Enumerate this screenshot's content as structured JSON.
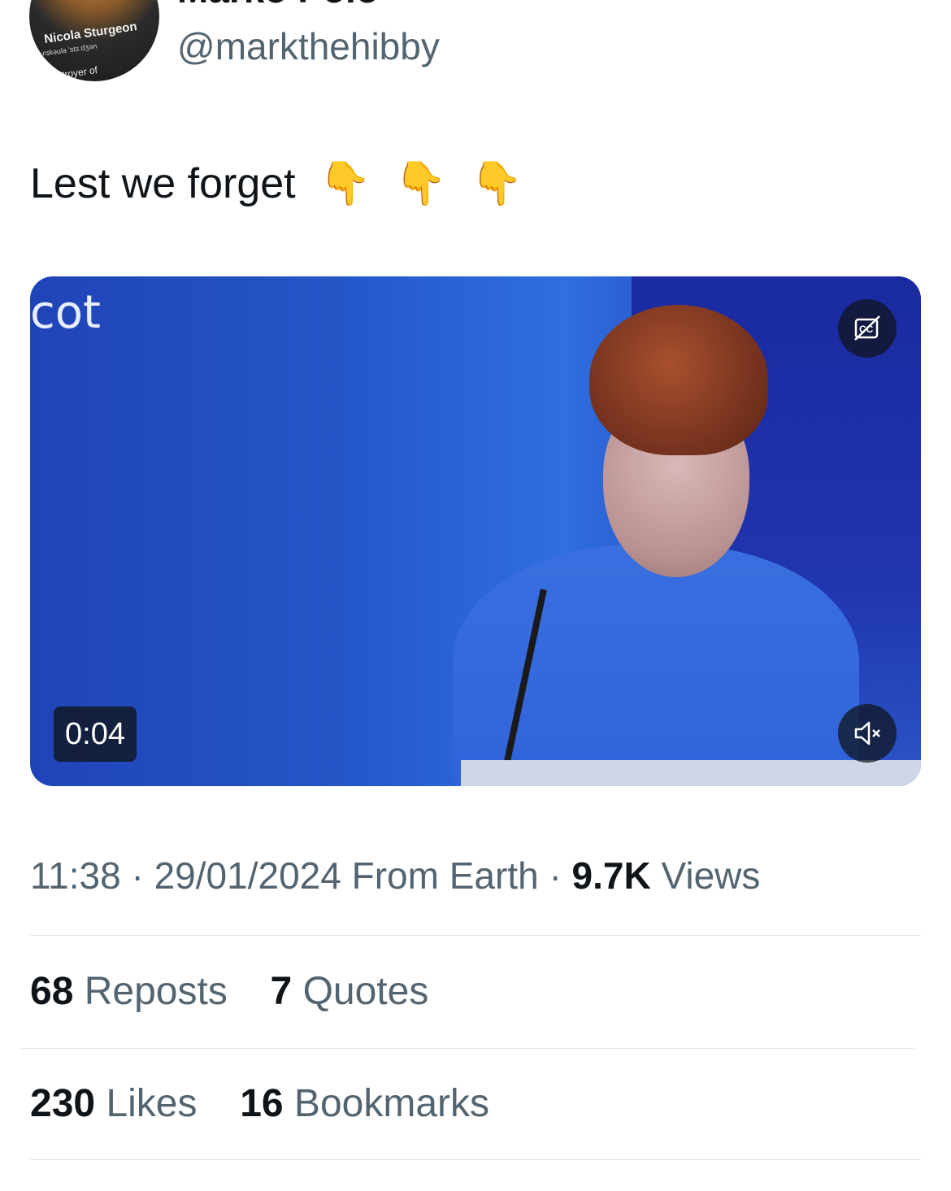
{
  "author": {
    "display_name": "Marko Polo",
    "handle": "@markthehibby",
    "avatar_shirt_text": "Nicola Sturgeon",
    "avatar_shirt_sub": "nɪkəula 'stɜːdʒən",
    "avatar_shirt_sub2": "troyer of"
  },
  "tweet": {
    "text": "Lest we forget",
    "emojis": [
      "👇",
      "👇",
      "👇"
    ]
  },
  "media": {
    "screen_text": "cot",
    "duration": "0:04",
    "cc_icon": "cc-off-icon",
    "mute_icon": "muted-speaker-icon"
  },
  "meta": {
    "time": "11:38",
    "date": "29/01/2024",
    "source": "From Earth",
    "separator": "·",
    "views_count": "9.7K",
    "views_label": "Views"
  },
  "stats": {
    "reposts_count": "68",
    "reposts_label": "Reposts",
    "quotes_count": "7",
    "quotes_label": "Quotes",
    "likes_count": "230",
    "likes_label": "Likes",
    "bookmarks_count": "16",
    "bookmarks_label": "Bookmarks"
  },
  "colors": {
    "text_primary": "#0f1419",
    "text_secondary": "#536471",
    "divider": "#e1e5e8"
  }
}
